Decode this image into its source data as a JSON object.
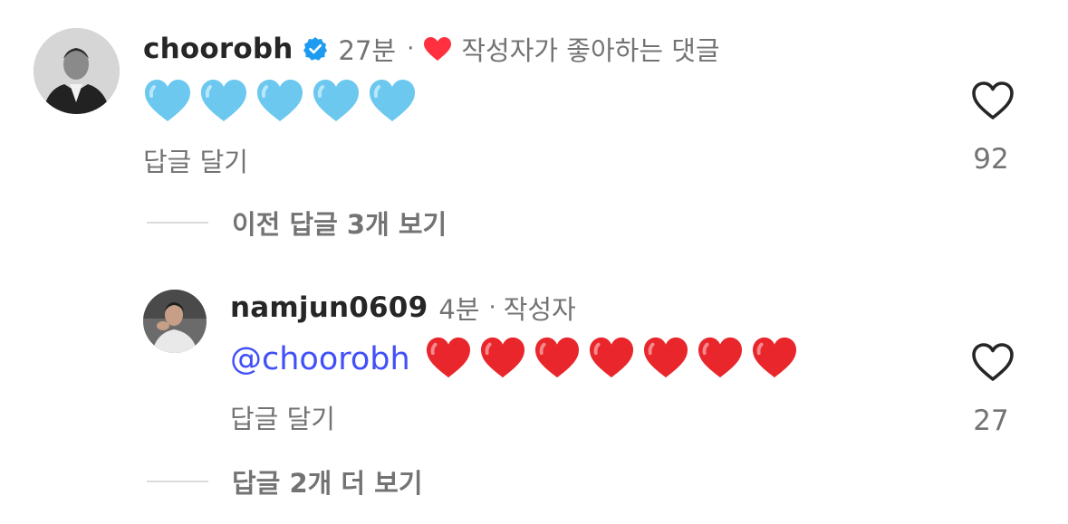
{
  "comment": {
    "username": "choorobh",
    "time": "27분",
    "separator": "·",
    "liked_by_author": "작성자가 좋아하는 댓글",
    "body_emoji": [
      "🩵",
      "🩵",
      "🩵",
      "🩵",
      "🩵"
    ],
    "reply_label": "답글 달기",
    "like_count": "92",
    "view_previous_replies": "이전 답글 3개 보기"
  },
  "reply": {
    "username": "namjun0609",
    "time": "4분",
    "separator": "·",
    "author_badge": "작성자",
    "mention": "@choorobh",
    "body_emoji": [
      "❤️",
      "❤️",
      "❤️",
      "❤️",
      "❤️",
      "❤️",
      "❤️"
    ],
    "reply_label": "답글 달기",
    "like_count": "27",
    "view_more_replies": "답글 2개 더 보기"
  },
  "colors": {
    "verified_badge": "#1d9bf0",
    "liked_heart": "#ff3040",
    "mention": "#4150f7",
    "light_blue_heart": "#6cc8ee",
    "red_heart": "#e8262b",
    "secondary_text": "#737373",
    "primary_text": "#262626"
  },
  "icons": {
    "verified": "verified-badge-icon",
    "liked": "red-heart-icon",
    "like_button": "heart-outline-icon"
  }
}
